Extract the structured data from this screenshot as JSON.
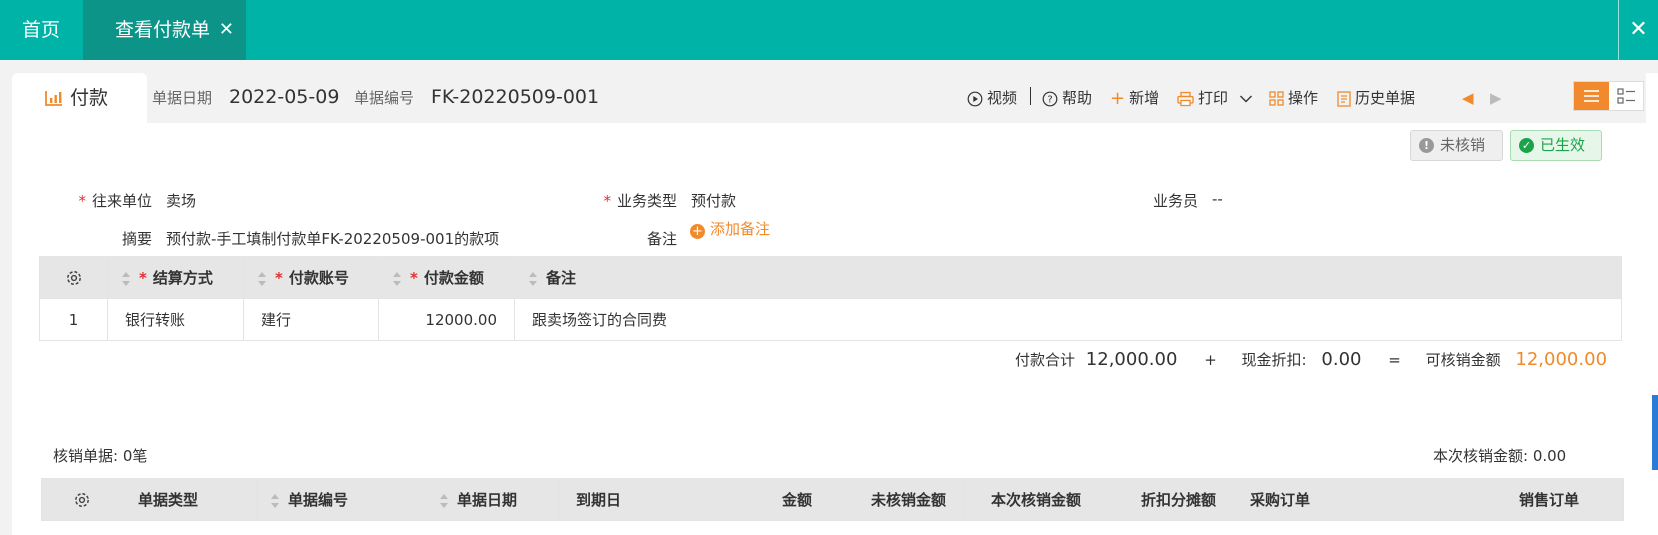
{
  "tabs": {
    "home": "首页",
    "active": "查看付款单"
  },
  "doc": {
    "tab_label": "付款",
    "date_label": "单据日期",
    "date_value": "2022-05-09",
    "number_label": "单据编号",
    "number_value": "FK-20220509-001"
  },
  "toolbar": {
    "video": "视频",
    "help": "帮助",
    "add": "新增",
    "print": "打印",
    "operate": "操作",
    "history": "历史单据"
  },
  "status": {
    "unverified": "未核销",
    "effective": "已生效"
  },
  "form": {
    "partner_label": "往来单位",
    "partner_value": "卖场",
    "biz_type_label": "业务类型",
    "biz_type_value": "预付款",
    "salesman_label": "业务员",
    "salesman_value": "--",
    "summary_label": "摘要",
    "summary_value": "预付款-手工填制付款单FK-20220509-001的款项",
    "remark_label": "备注",
    "add_remark": "添加备注"
  },
  "payment_table": {
    "headers": [
      "结算方式",
      "付款账号",
      "付款金额",
      "备注"
    ],
    "rows": [
      {
        "index": "1",
        "method": "银行转账",
        "account": "建行",
        "amount": "12000.00",
        "remark": "跟卖场签订的合同费"
      }
    ]
  },
  "totals": {
    "payment_label": "付款合计",
    "payment_value": "12,000.00",
    "plus": "+",
    "discount_label": "现金折扣:",
    "discount_value": "0.00",
    "equals": "=",
    "verifiable_label": "可核销金额",
    "verifiable_value": "12,000.00"
  },
  "verify": {
    "count_text": "核销单据: 0笔",
    "amount_text": "本次核销金额: 0.00",
    "headers": [
      "单据类型",
      "单据编号",
      "单据日期",
      "到期日",
      "金额",
      "未核销金额",
      "本次核销金额",
      "折扣分摊额",
      "采购订单",
      "销售订单"
    ]
  },
  "colors": {
    "topbar": "#00b3a7",
    "active_tab": "#0c9488",
    "accent": "#f08a2c",
    "required": "#e03030",
    "success": "#1aa34a"
  }
}
